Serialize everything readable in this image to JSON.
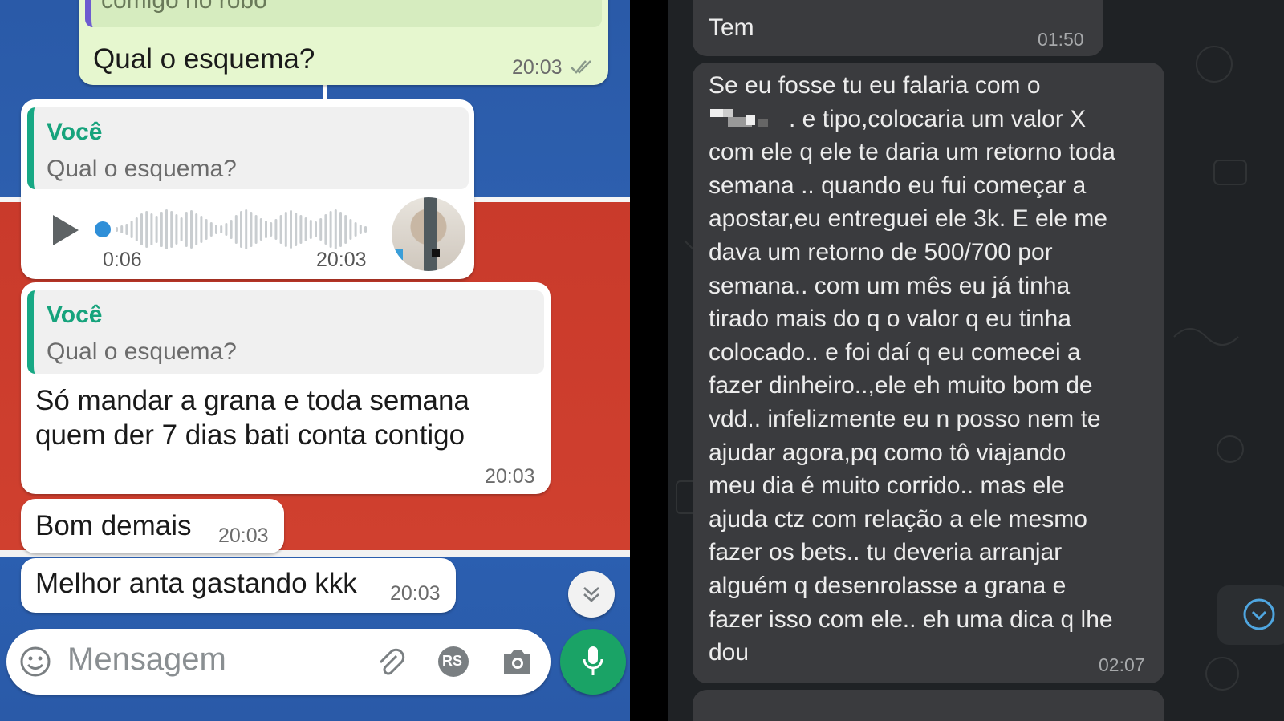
{
  "left": {
    "top_quote_text": "comigo no robô",
    "msg1": {
      "text": "Qual o esquema?",
      "time": "20:03",
      "status_icon": "double-check-icon"
    },
    "msg2": {
      "quote_author": "Você",
      "quote_text": "Qual o esquema?",
      "audio_duration": "0:06",
      "time": "20:03",
      "icon": "play-icon"
    },
    "msg3": {
      "quote_author": "Você",
      "quote_text": "Qual o esquema?",
      "text_line1": "Só mandar a grana e toda semana",
      "text_line2": "quem der 7 dias bati conta contigo",
      "time": "20:03"
    },
    "msg4": {
      "text": "Bom demais",
      "time": "20:03"
    },
    "msg5": {
      "text": "Melhor anta gastando kkk",
      "time": "20:03"
    },
    "scroll_down_icon": "double-chevron-down-icon",
    "composer": {
      "placeholder": "Mensagem",
      "emoji_icon": "emoji-icon",
      "attach_icon": "paperclip-icon",
      "currency_icon": "rs-icon",
      "currency_label": "RS",
      "camera_icon": "camera-icon",
      "mic_icon": "microphone-icon"
    },
    "colors": {
      "accent_green": "#17a884",
      "outgoing_bubble": "#e6f7cf",
      "incoming_bubble": "#ffffff"
    }
  },
  "right": {
    "msg1": {
      "text": "Tem",
      "time": "01:50"
    },
    "msg2": {
      "lines": [
        "Se eu fosse tu eu falaria com o",
        ". e tipo,colocaria um valor X",
        "com ele q ele te daria um retorno toda",
        "semana .. quando eu fui começar a",
        "apostar,eu entreguei ele 3k. E ele me",
        "dava um retorno de 500/700 por",
        "semana.. com um mês eu já tinha",
        "tirado mais do q o valor q eu tinha",
        "colocado.. e foi daí q eu comecei a",
        "fazer dinheiro..,ele eh muito bom de",
        "vdd.. infelizmente eu n posso nem te",
        "ajudar agora,pq como tô viajando",
        "meu dia é muito corrido.. mas ele",
        "ajuda ctz com relação a ele mesmo",
        "fazer os bets.. tu deveria arranjar",
        "alguém q desenrolasse a grana e",
        "fazer isso com ele.. eh uma dica q lhe",
        "dou"
      ],
      "time": "02:07"
    },
    "scroll_icon": "chevron-down-icon",
    "colors": {
      "background": "#1f2225",
      "bubble": "#3a3b3e"
    }
  }
}
